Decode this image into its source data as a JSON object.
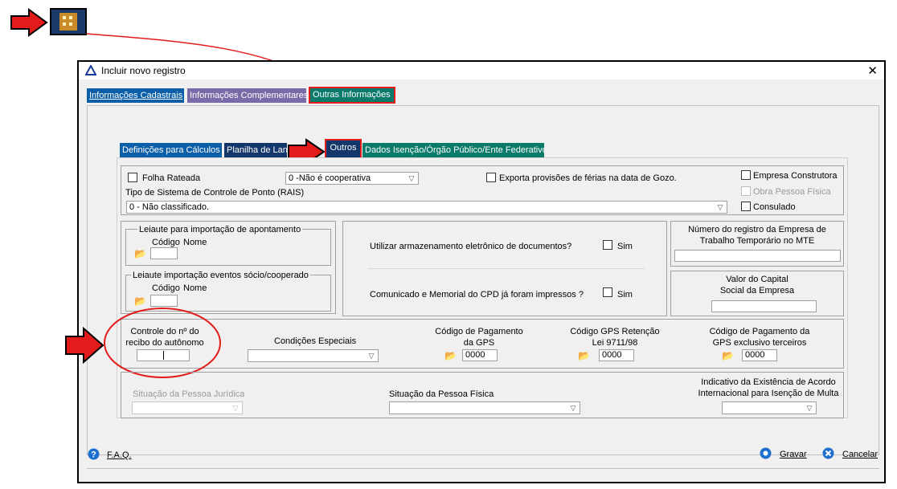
{
  "window": {
    "title": "Incluir novo registro",
    "close": "✕"
  },
  "top_tabs": [
    "Informações Cadastrais",
    "Informações Complementares",
    "Outras Informações"
  ],
  "sub_tabs": [
    "Definições para Cálculos",
    "Planilha de Lan",
    "Outros",
    "Dados Isenção/Órgão Público/Ente Federativo"
  ],
  "outros": {
    "folha_rateada": "Folha Rateada",
    "cooperativa_select": "0 -Não é cooperativa",
    "exporta_provisoes": "Exporta provisões de férias na data de Gozo.",
    "empresa_construtora": "Empresa Construtora",
    "obra_pessoa_fisica": "Obra Pessoa Física",
    "consulado": "Consulado",
    "tipo_sistema_label": "Tipo de Sistema de Controle de Ponto (RAIS)",
    "tipo_sistema_value": "0 - Não classificado.",
    "leiaute_apontamento": "Leiaute para importação de apontamento",
    "leiaute_eventos": "Leiaute importação eventos sócio/cooperado",
    "codigo": "Código",
    "nome": "Nome",
    "armazenamento": "Utilizar armazenamento eletrônico de documentos?",
    "comunicado": "Comunicado e Memorial do CPD já foram impressos ?",
    "sim": "Sim",
    "numero_registro": "Número do registro da Empresa de Trabalho Temporário no MTE",
    "capital_social": "Valor do Capital Social da Empresa",
    "controle_recibo": "Controle do nº do recibo do autônomo",
    "condicoes_especiais": "Condições Especiais",
    "codigo_gps": "Código de Pagamento da GPS",
    "codigo_gps_retencao": "Código GPS Retenção Lei 9711/98",
    "codigo_gps_terceiros": "Código de Pagamento da GPS exclusivo terceiros",
    "gps_value": "0000",
    "gps_retencao_value": "0000",
    "gps_terceiros_value": "0000",
    "situacao_pj": "Situação da Pessoa Jurídica",
    "situacao_pf": "Situação da Pessoa Física",
    "indicativo_acordo": "Indicativo da Existência de Acordo Internacional para Isenção de Multa"
  },
  "footer": {
    "faq": "F.A.Q.",
    "gravar": "Gravar",
    "cancelar": "Cancelar"
  },
  "colors": {
    "annotation_red": "#e31b1b",
    "tab_blue": "#0b5fa8",
    "tab_purple": "#7a6aa8",
    "tab_teal": "#0a7a6a",
    "tab_navy": "#13366b"
  },
  "icons": [
    "app-icon",
    "warning-icon",
    "close-icon",
    "folder-icon",
    "help-icon",
    "save-icon",
    "cancel-icon",
    "arrow-icon"
  ]
}
